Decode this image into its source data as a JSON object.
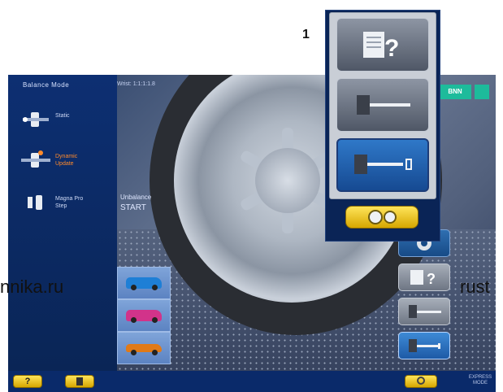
{
  "callout_number": "1",
  "sidebar": {
    "title": "Balance Mode",
    "items": [
      {
        "label": "Static"
      },
      {
        "label": "Dynamic\nUpdate",
        "active": true
      },
      {
        "label": "Magna Pro\nStep"
      }
    ]
  },
  "topbar": {
    "readout": "Wrist: 1:1:1:1.8",
    "logo": "BNN"
  },
  "center": {
    "line1": "Unbalance",
    "line2": "START"
  },
  "vehicles": [
    {
      "name": "van-icon",
      "color": "#1e7fd6"
    },
    {
      "name": "suv-icon",
      "color": "#d2338a"
    },
    {
      "name": "car-icon",
      "color": "#e07a18"
    }
  ],
  "right_buttons": [
    {
      "name": "gear-icon"
    },
    {
      "name": "help-icon"
    },
    {
      "name": "weight-tool-icon"
    },
    {
      "name": "weight-tool-icon"
    }
  ],
  "popup": {
    "buttons": [
      {
        "name": "help-icon"
      },
      {
        "name": "weight-tool-icon"
      },
      {
        "name": "weight-tool-icon",
        "selected": true
      }
    ],
    "gear": "gear-icon"
  },
  "bottombar": {
    "help_label": "?",
    "status": "EXPRESS\nMODE"
  },
  "watermarks": {
    "left": "nnika.ru",
    "right": "rust"
  },
  "colors": {
    "accent": "#1e5aa6",
    "highlight": "#ff8a2a",
    "brand": "#1dbb9b"
  }
}
